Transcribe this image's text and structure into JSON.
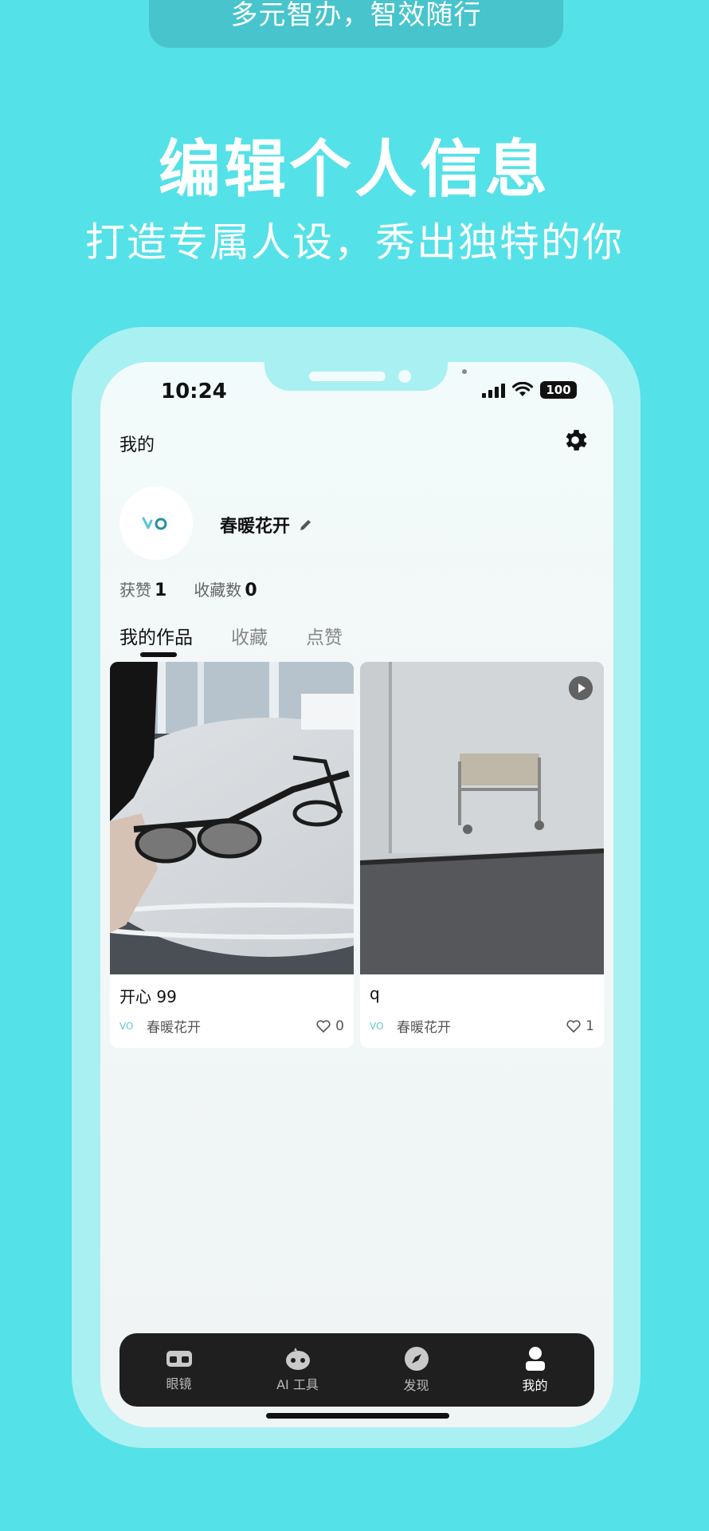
{
  "banner": {
    "top_pill": "多元智办，智效随行",
    "headline": "编辑个人信息",
    "subheadline": "打造专属人设，秀出独特的你"
  },
  "status_bar": {
    "time": "10:24",
    "battery": "100"
  },
  "header": {
    "title": "我的",
    "settings_icon": "gear-icon"
  },
  "profile": {
    "avatar_text": "VO",
    "username": "春暖花开",
    "edit_icon": "pencil-icon",
    "stats": [
      {
        "label": "获赞",
        "value": "1"
      },
      {
        "label": "收藏数",
        "value": "0"
      }
    ]
  },
  "tabs": [
    {
      "label": "我的作品",
      "active": true
    },
    {
      "label": "收藏",
      "active": false
    },
    {
      "label": "点赞",
      "active": false
    }
  ],
  "cards": [
    {
      "title": "开心 99",
      "author": "春暖花开",
      "likes": "0",
      "video": false
    },
    {
      "title": "q",
      "author": "春暖花开",
      "likes": "1",
      "video": true
    }
  ],
  "navbar": [
    {
      "label": "眼镜",
      "icon": "glasses-icon",
      "active": false
    },
    {
      "label": "AI 工具",
      "icon": "robot-icon",
      "active": false
    },
    {
      "label": "发现",
      "icon": "compass-icon",
      "active": false
    },
    {
      "label": "我的",
      "icon": "user-icon",
      "active": true
    }
  ],
  "colors": {
    "background": "#55e1e8",
    "frame": "#a9f0f3",
    "accent": "#66c8d4",
    "navbar": "#1f1f1f"
  }
}
